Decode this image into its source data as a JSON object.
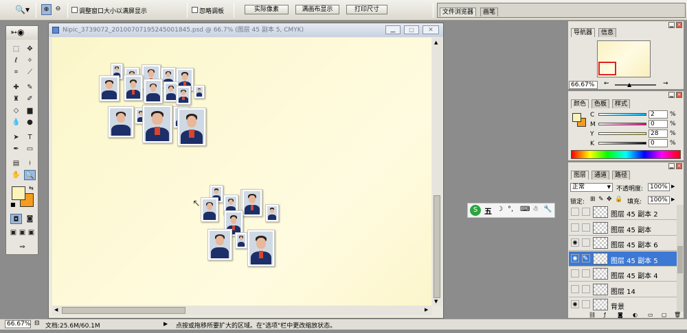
{
  "options": {
    "resize_windows_label": "调整窗口大小以满屏显示",
    "ignore_palettes_label": "忽略调板",
    "actual_pixels": "实际像素",
    "fit_screen": "满画布显示",
    "print_size": "打印尺寸",
    "well_tabs": [
      "文件浏览器",
      "画笔"
    ]
  },
  "document": {
    "title": "Nipic_3739072_20100707195245001845.psd @ 66.7% (图层 45 副本 5, CMYK)"
  },
  "navigator": {
    "tabs": [
      "导航器",
      "信息"
    ],
    "zoom": "66.67%"
  },
  "color": {
    "tabs": [
      "颜色",
      "色板",
      "样式"
    ],
    "channels": [
      {
        "label": "C",
        "value": "2",
        "unit": "%"
      },
      {
        "label": "M",
        "value": "0",
        "unit": "%"
      },
      {
        "label": "Y",
        "value": "28",
        "unit": "%"
      },
      {
        "label": "K",
        "value": "0",
        "unit": "%"
      }
    ],
    "foreground": "#fbf3b8",
    "background": "#f39c1f"
  },
  "layers": {
    "tabs": [
      "图层",
      "通道",
      "路径"
    ],
    "blend_mode": "正常",
    "opacity_label": "不透明度:",
    "opacity": "100%",
    "lock_label": "锁定:",
    "fill_label": "填充:",
    "fill": "100%",
    "rows": [
      {
        "name": "图层 45 副本 2",
        "visible": false,
        "selected": false
      },
      {
        "name": "图层 45 副本",
        "visible": false,
        "selected": false
      },
      {
        "name": "图层 45 副本 6",
        "visible": true,
        "selected": false
      },
      {
        "name": "图层 45 副本 5",
        "visible": true,
        "selected": true
      },
      {
        "name": "图层 45 副本 4",
        "visible": false,
        "selected": false
      },
      {
        "name": "图层 14",
        "visible": false,
        "selected": false
      },
      {
        "name": "背景",
        "visible": true,
        "selected": false
      }
    ]
  },
  "ime": {
    "label": "五"
  },
  "status": {
    "zoom": "66.67%",
    "doc_size": "文档:25.6M/60.1M",
    "hint": "点按或拖移所要扩大的区域。在\"选项\"栏中更改缩放状态。"
  }
}
